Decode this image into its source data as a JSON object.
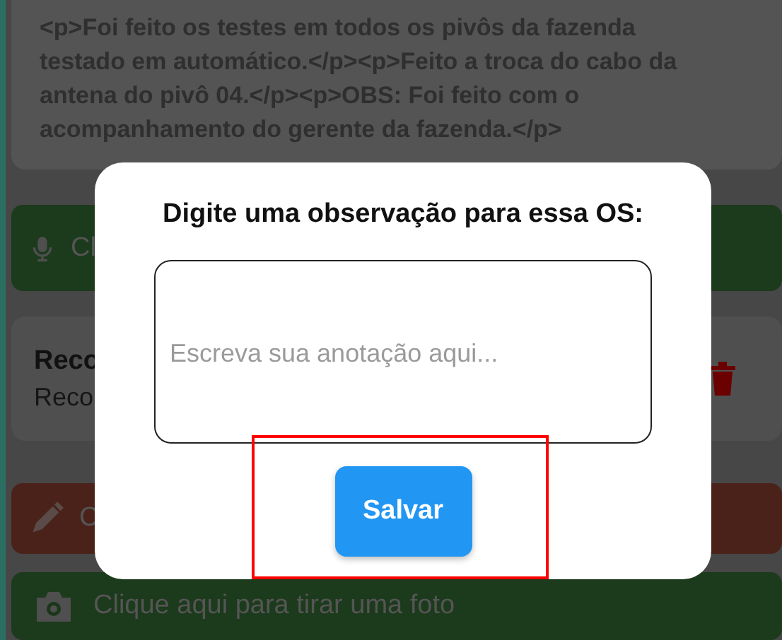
{
  "note": {
    "text": "<p>Foi feito os testes em todos os pivôs da fazenda testado em automático.</p><p>Feito a troca do cabo da antena do pivô 04.</p><p>OBS: Foi feito com o acompanhamento do gerente da fazenda.</p>"
  },
  "record_button": {
    "label": "Cl"
  },
  "recording_card": {
    "title": "Reco",
    "subtitle": "Reco"
  },
  "edit_button": {
    "label": "C"
  },
  "photo_button": {
    "label": "Clique aqui para tirar uma foto"
  },
  "dialog": {
    "title": "Digite uma observação para essa OS:",
    "field": {
      "placeholder": "Escreva sua anotação aqui..."
    },
    "buttons": [
      "Salvar"
    ]
  }
}
